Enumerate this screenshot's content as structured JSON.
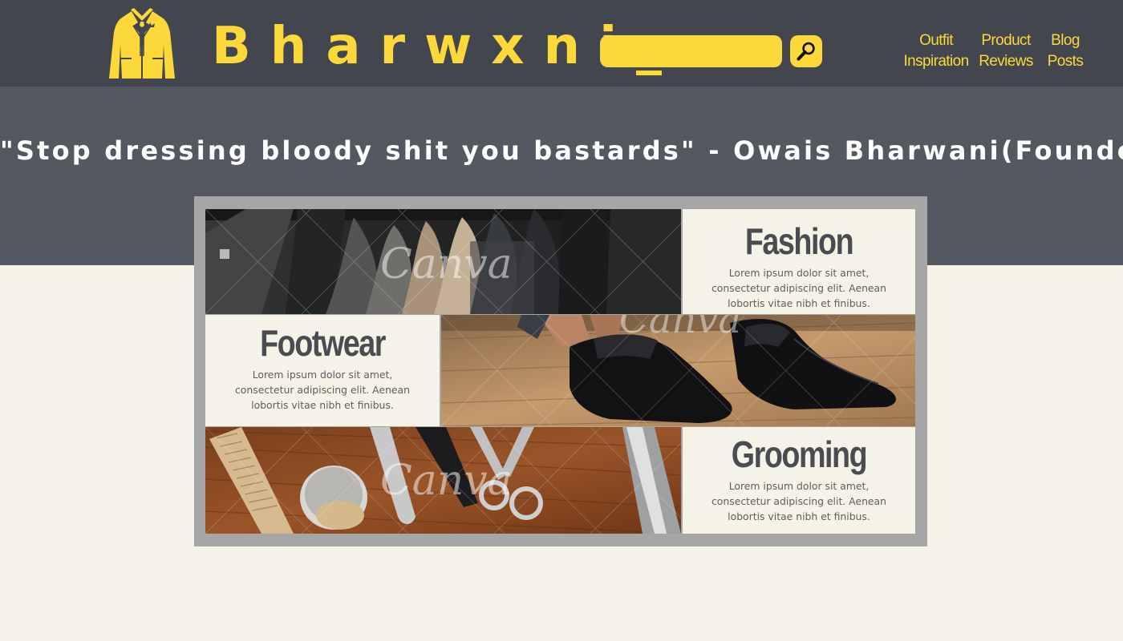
{
  "header": {
    "brand": "Bharwxni_",
    "logo_icon": "jacket-icon",
    "search": {
      "value": "",
      "placeholder": "",
      "button_icon": "magnifier-icon"
    },
    "nav": [
      {
        "line1": "Outfit",
        "line2": "Inspiration"
      },
      {
        "line1": "Product",
        "line2": "Reviews"
      },
      {
        "line1": "Blog",
        "line2": "Posts"
      }
    ]
  },
  "hero": {
    "quote": "\"Stop dressing bloody shit you bastards\" - Owais Bharwani(Founder)"
  },
  "categories": [
    {
      "title": "Fashion",
      "text": "Lorem ipsum dolor sit amet, consectetur adipiscing elit. Aenean lobortis vitae nibh et finibus.",
      "image": "clothes-rack-photo"
    },
    {
      "title": "Footwear",
      "text": "Lorem ipsum dolor sit amet, consectetur adipiscing elit. Aenean lobortis vitae nibh et finibus.",
      "image": "leather-shoes-photo"
    },
    {
      "title": "Grooming",
      "text": "Lorem ipsum dolor sit amet, consectetur adipiscing elit. Aenean lobortis vitae nibh et finibus.",
      "image": "grooming-tools-photo"
    }
  ],
  "watermark": "Canva",
  "colors": {
    "header_bg": "#43464f",
    "hero_bg": "#545860",
    "accent": "#fdd83a",
    "page_bg": "#f5f3e7",
    "panel_frame": "#a6a6a6",
    "card_text": "#4a4c52"
  }
}
